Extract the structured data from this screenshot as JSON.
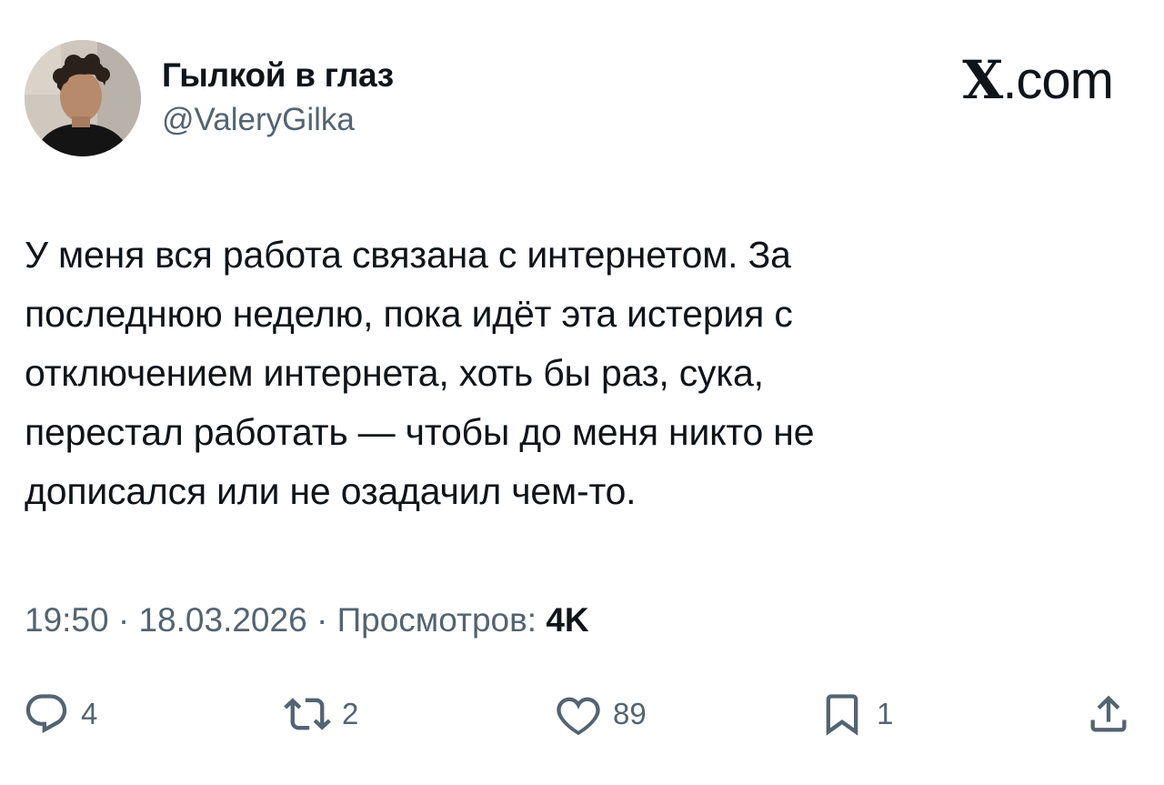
{
  "author": {
    "display_name": "Гылкой в глаз",
    "handle": "@ValeryGilka"
  },
  "brand": {
    "logo": "X",
    "suffix": ".com"
  },
  "tweet": {
    "lines": [
      "У меня вся работа связана с интернетом. За",
      "последнюю неделю, пока идёт эта истерия с",
      "отключением интернета, хоть бы раз, сука,",
      "перестал работать — чтобы до меня никто не",
      "дописался или не озадачил чем-то."
    ]
  },
  "meta": {
    "time": "19:50",
    "separator": "·",
    "date": "18.03.2026",
    "views_label": "Просмотров:",
    "views_count": "4K"
  },
  "actions": {
    "reply_count": "4",
    "retweet_count": "2",
    "like_count": "89",
    "bookmark_count": "1"
  },
  "icons": {
    "reply": "reply-icon",
    "retweet": "retweet-icon",
    "like": "heart-icon",
    "bookmark": "bookmark-icon",
    "share": "share-icon"
  },
  "colors": {
    "text": "#0f1419",
    "secondary": "#536471"
  }
}
